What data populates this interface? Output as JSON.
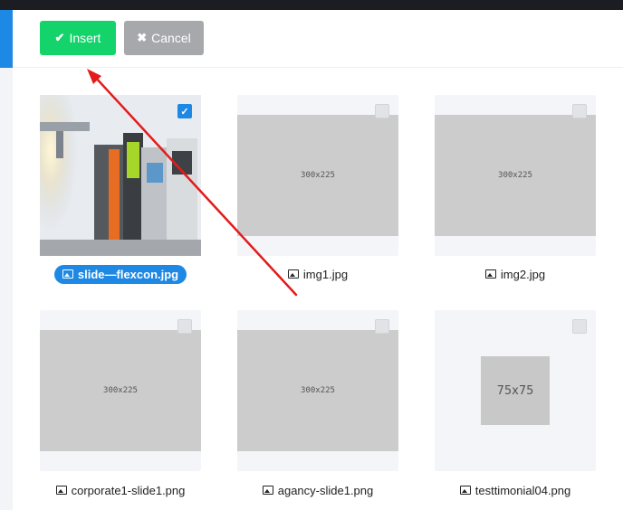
{
  "toolbar": {
    "insert_label": "Insert",
    "cancel_label": "Cancel",
    "insert_color": "#14d36b",
    "cancel_color": "#a6a8ab"
  },
  "images": [
    {
      "filename": "slide—flexcon.jpg",
      "selected": true,
      "dimensions": ""
    },
    {
      "filename": "img1.jpg",
      "selected": false,
      "dimensions": "300x225"
    },
    {
      "filename": "img2.jpg",
      "selected": false,
      "dimensions": "300x225"
    },
    {
      "filename": "corporate1-slide1.png",
      "selected": false,
      "dimensions": "300x225"
    },
    {
      "filename": "agancy-slide1.png",
      "selected": false,
      "dimensions": "300x225"
    },
    {
      "filename": "testtimonial04.png",
      "selected": false,
      "dimensions": "75x75"
    }
  ],
  "accent_color": "#1e88e5",
  "annotation_color": "#e31b1b"
}
